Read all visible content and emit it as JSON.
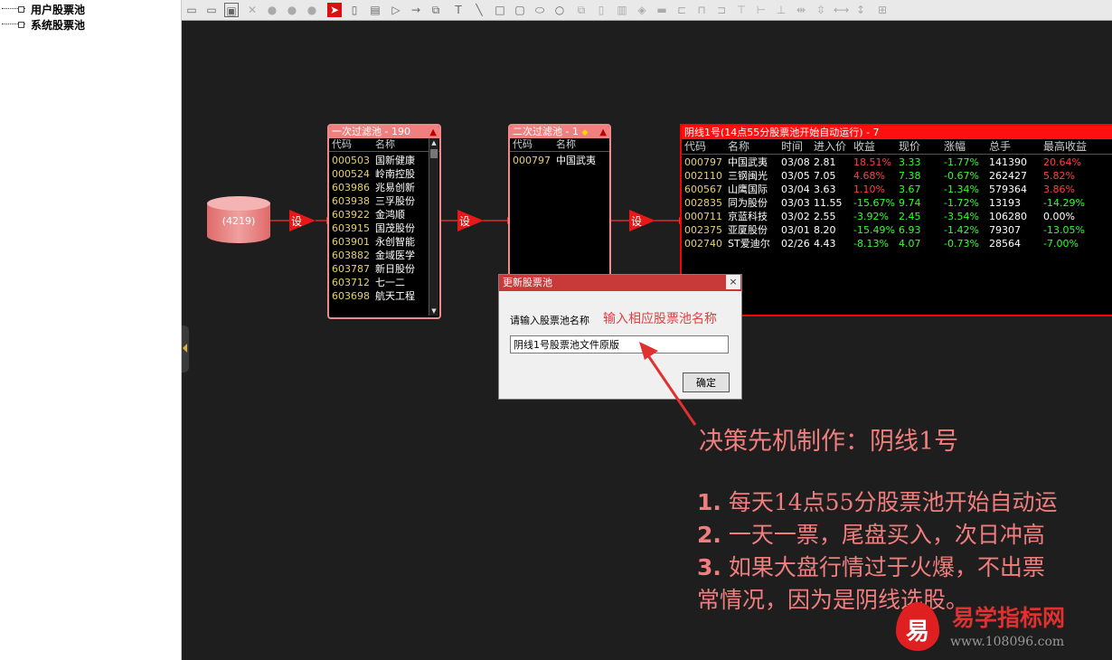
{
  "tree": {
    "items": [
      {
        "label": "用户股票池"
      },
      {
        "label": "系统股票池"
      }
    ]
  },
  "toolbar": {
    "icons": [
      "new-icon",
      "open-icon",
      "save-icon",
      "delete-icon",
      "play-icon",
      "pause-icon",
      "stop-icon",
      "select-arrow-icon",
      "cylinder-icon",
      "document-icon",
      "triangle-icon",
      "arrow-line-icon",
      "copy-icon",
      "text-icon",
      "line-icon",
      "square-icon",
      "rounded-rect-icon",
      "ellipse-icon",
      "circle-icon",
      "copy-2-icon",
      "paste-icon",
      "trash-icon",
      "fill-icon",
      "line-style-icon",
      "align-left-icon",
      "align-center-icon",
      "align-right-icon",
      "align-top-icon",
      "align-middle-icon",
      "align-bottom-icon",
      "distribute-h-icon",
      "distribute-v-icon",
      "same-width-icon",
      "same-height-icon",
      "grid-icon"
    ]
  },
  "pool": {
    "label": "(4219)"
  },
  "set_label": "设",
  "filter1": {
    "title": "一次过滤池 - 190",
    "headers": {
      "code": "代码",
      "name": "名称"
    },
    "rows": [
      {
        "code": "000503",
        "name": "国新健康"
      },
      {
        "code": "000524",
        "name": "岭南控股"
      },
      {
        "code": "603986",
        "name": "兆易创新"
      },
      {
        "code": "603938",
        "name": "三孚股份"
      },
      {
        "code": "603922",
        "name": "金鸿顺"
      },
      {
        "code": "603915",
        "name": "国茂股份"
      },
      {
        "code": "603901",
        "name": "永创智能"
      },
      {
        "code": "603882",
        "name": "金域医学"
      },
      {
        "code": "603787",
        "name": "新日股份"
      },
      {
        "code": "603712",
        "name": "七一二"
      },
      {
        "code": "603698",
        "name": "航天工程"
      }
    ]
  },
  "filter2": {
    "title": "二次过滤池 - 1",
    "headers": {
      "code": "代码",
      "name": "名称"
    },
    "rows": [
      {
        "code": "000797",
        "name": "中国武夷"
      }
    ]
  },
  "result": {
    "title": "阴线1号(14点55分股票池开始自动运行) - 7",
    "headers": {
      "code": "代码",
      "name": "名称",
      "time": "时间",
      "price": "进入价",
      "gain": "收益",
      "current": "现价",
      "change": "涨幅",
      "volume": "总手",
      "max": "最高收益"
    },
    "rows": [
      {
        "code": "000797",
        "name": "中国武夷",
        "time": "03/08",
        "price": "2.81",
        "gain": "18.51%",
        "current": "3.33",
        "change": "-1.77%",
        "volume": "141390",
        "max": "20.64%"
      },
      {
        "code": "002110",
        "name": "三钢闽光",
        "time": "03/05",
        "price": "7.05",
        "gain": "4.68%",
        "current": "7.38",
        "change": "-0.67%",
        "volume": "262427",
        "max": "5.82%"
      },
      {
        "code": "600567",
        "name": "山鹰国际",
        "time": "03/04",
        "price": "3.63",
        "gain": "1.10%",
        "current": "3.67",
        "change": "-1.34%",
        "volume": "579364",
        "max": "3.86%"
      },
      {
        "code": "002835",
        "name": "同为股份",
        "time": "03/03",
        "price": "11.55",
        "gain": "-15.67%",
        "current": "9.74",
        "change": "-1.72%",
        "volume": "13193",
        "max": "-14.29%"
      },
      {
        "code": "000711",
        "name": "京蓝科技",
        "time": "03/02",
        "price": "2.55",
        "gain": "-3.92%",
        "current": "2.45",
        "change": "-3.54%",
        "volume": "106280",
        "max": "0.00%"
      },
      {
        "code": "002375",
        "name": "亚厦股份",
        "time": "03/01",
        "price": "8.20",
        "gain": "-15.49%",
        "current": "6.93",
        "change": "-1.42%",
        "volume": "79307",
        "max": "-13.05%"
      },
      {
        "code": "002740",
        "name": "ST爱迪尔",
        "time": "02/26",
        "price": "4.43",
        "gain": "-8.13%",
        "current": "4.07",
        "change": "-0.73%",
        "volume": "28564",
        "max": "-7.00%"
      }
    ]
  },
  "dialog": {
    "title": "更新股票池",
    "close": "×",
    "prompt": "请输入股票池名称",
    "hint": "输入相应股票池名称",
    "input_value": "阴线1号股票池文件原版",
    "ok_label": "确定"
  },
  "annotation": {
    "headline": "决策先机制作：阴线1号",
    "items": [
      {
        "num": "1.",
        "text": " 每天14点55分股票池开始自动运"
      },
      {
        "num": "2.",
        "text": " 一天一票，尾盘买入，次日冲高"
      },
      {
        "num": "3.",
        "text": " 如果大盘行情过于火爆，不出票"
      },
      {
        "num": "",
        "text": "常情况，因为是阴线选股。"
      }
    ]
  },
  "watermark": {
    "logo_char": "易",
    "name": "易学指标网",
    "url": "www.108096.com"
  },
  "colors": {
    "canvas": "#1e1e1e",
    "node_border": "#f08a8a",
    "result_border": "#ff0000",
    "accent": "#e04040"
  }
}
